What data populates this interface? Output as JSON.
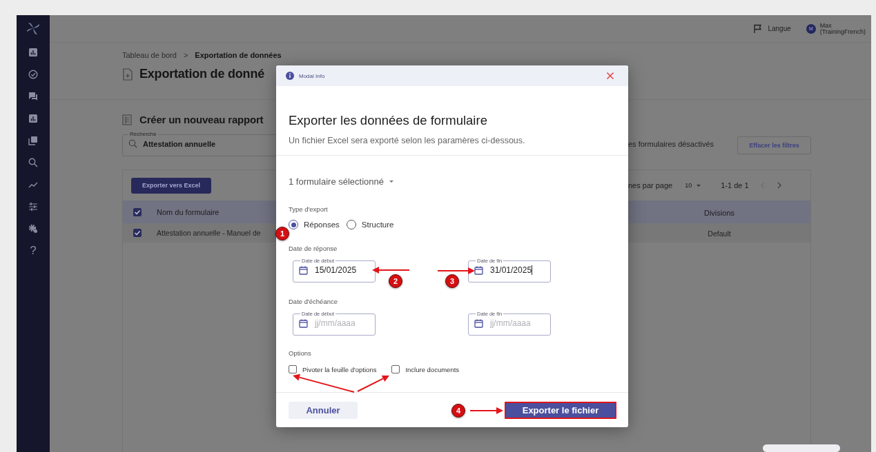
{
  "top_bar": {
    "language": "Langue",
    "user_initial": "M",
    "user_name": "Max",
    "user_account": "(TrainingFrench)"
  },
  "sidebar": {
    "help": "?"
  },
  "breadcrumb": {
    "items": [
      "Tableau de bord",
      "Exportation de données"
    ],
    "separator": ">"
  },
  "page_title": "Exportation de donné",
  "section_title": "Créer un nouveau rapport",
  "search": {
    "label": "Recherche",
    "value": "Attestation annuelle"
  },
  "filter_text": "es formulaires désactivés",
  "clear_filters": "Effacer les filtres",
  "table": {
    "export_button": "Exporter vers Excel",
    "rows_per_page_label": "nes par page",
    "rows_per_page": "10",
    "range": "1-1 de 1",
    "header_checked": true,
    "columns": [
      "Nom du formulaire",
      "Divisions"
    ],
    "rows": [
      {
        "checked": true,
        "cells": [
          "Attestation annuelle - Manuel de",
          "Default"
        ]
      }
    ]
  },
  "modal": {
    "header": "Modal Info",
    "title": "Exporter les données de formulaire",
    "subtitle": "Un fichier Excel sera exporté selon les paramères ci-dessous.",
    "form_select": "1 formulaire sélectionné",
    "export_type": {
      "label": "Type d'export",
      "options": [
        {
          "label": "Réponses",
          "selected": true
        },
        {
          "label": "Structure",
          "selected": false
        }
      ]
    },
    "date_groups": [
      {
        "label": "Date de réponse",
        "fields": [
          {
            "label": "Date de début",
            "value": "15/01/2025",
            "cursor": false
          },
          {
            "label": "Date de fin",
            "value": "31/01/2025",
            "cursor": true
          }
        ]
      },
      {
        "label": "Date d'échéance",
        "fields": [
          {
            "label": "Date de début",
            "placeholder": "jj/mm/aaaa",
            "cursor": false
          },
          {
            "label": "Date de fin",
            "placeholder": "jj/mm/aaaa",
            "cursor": false
          }
        ]
      }
    ],
    "options": {
      "label": "Options",
      "items": [
        {
          "label": "Pivoter la feuille d'options",
          "checked": false
        },
        {
          "label": "Inclure documents",
          "checked": false
        }
      ]
    },
    "cancel": "Annuler",
    "submit": {
      "label": "Exporter le fichier",
      "highlighted": true
    }
  },
  "annotations": [
    {
      "number": "1"
    },
    {
      "number": "2"
    },
    {
      "number": "3"
    },
    {
      "number": "4"
    }
  ]
}
